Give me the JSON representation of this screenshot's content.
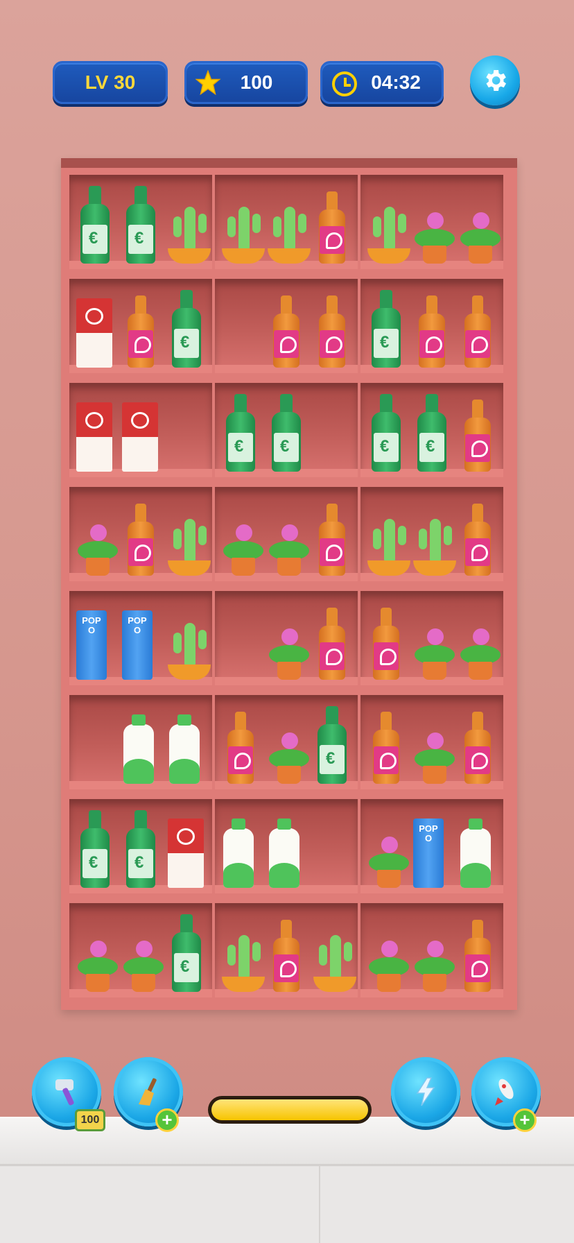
{
  "hud": {
    "level_label": "LV 30",
    "stars": "100",
    "timer": "04:32",
    "settings_icon": "gear-icon"
  },
  "shelf": {
    "rows": [
      [
        [
          "green-bottle",
          "green-bottle",
          "cactus"
        ],
        [
          "cactus",
          "cactus",
          "orange-bottle"
        ],
        [
          "cactus",
          "flower",
          "flower"
        ]
      ],
      [
        [
          "juice-carton",
          "orange-bottle",
          "green-bottle"
        ],
        [
          "",
          "orange-bottle",
          "orange-bottle"
        ],
        [
          "green-bottle",
          "orange-bottle",
          "orange-bottle"
        ]
      ],
      [
        [
          "juice-carton",
          "juice-carton",
          ""
        ],
        [
          "green-bottle",
          "green-bottle",
          ""
        ],
        [
          "green-bottle",
          "green-bottle",
          "orange-bottle"
        ]
      ],
      [
        [
          "flower",
          "orange-bottle",
          "cactus"
        ],
        [
          "flower",
          "flower",
          "orange-bottle"
        ],
        [
          "cactus",
          "cactus",
          "orange-bottle"
        ]
      ],
      [
        [
          "popo-can",
          "popo-can",
          "cactus"
        ],
        [
          "",
          "flower",
          "orange-bottle"
        ],
        [
          "orange-bottle",
          "flower",
          "flower"
        ]
      ],
      [
        [
          "",
          "milk-bottle",
          "milk-bottle"
        ],
        [
          "orange-bottle",
          "flower",
          "green-bottle"
        ],
        [
          "orange-bottle",
          "flower",
          "orange-bottle"
        ]
      ],
      [
        [
          "green-bottle",
          "green-bottle",
          "juice-carton"
        ],
        [
          "milk-bottle",
          "milk-bottle",
          ""
        ],
        [
          "flower",
          "popo-can",
          "milk-bottle"
        ]
      ],
      [
        [
          "flower",
          "flower",
          "green-bottle"
        ],
        [
          "cactus",
          "orange-bottle",
          "cactus"
        ],
        [
          "flower",
          "flower",
          "orange-bottle"
        ]
      ]
    ],
    "can_label": "POPO"
  },
  "boosters": {
    "hammer_count": "100",
    "plus_symbol": "+",
    "progress_fraction": 1.0,
    "icons": [
      "hammer-icon",
      "broom-icon",
      "lightning-icon",
      "rocket-icon"
    ]
  },
  "colors": {
    "hud_blue": "#1f5bbd",
    "accent_yellow": "#ffd83a",
    "shelf_pink": "#df7c78",
    "booster_cyan": "#1aa6e6"
  }
}
